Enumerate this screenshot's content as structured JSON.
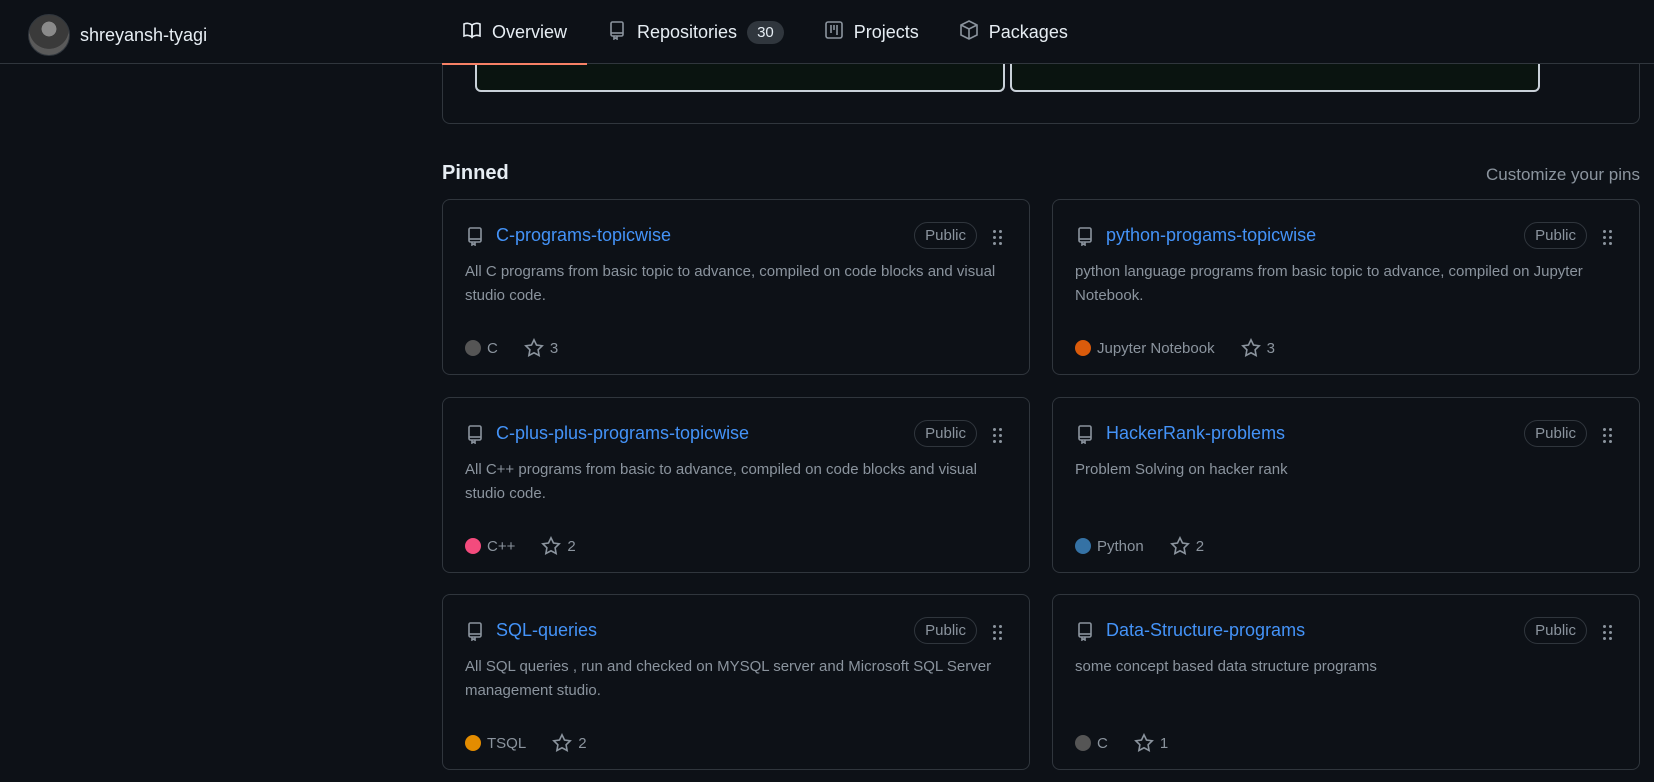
{
  "profile": {
    "username": "shreyansh-tyagi"
  },
  "tabs": [
    {
      "label": "Overview",
      "icon": "book-icon",
      "active": true
    },
    {
      "label": "Repositories",
      "icon": "repo-icon",
      "count": "30"
    },
    {
      "label": "Projects",
      "icon": "project-icon"
    },
    {
      "label": "Packages",
      "icon": "package-icon"
    }
  ],
  "pinned": {
    "title": "Pinned",
    "customize_label": "Customize your pins",
    "repos": [
      {
        "name": "C-programs-topicwise",
        "visibility": "Public",
        "description": "All C programs from basic topic to advance, compiled on code blocks and visual studio code.",
        "language": "C",
        "language_color": "#555555",
        "stars": "3"
      },
      {
        "name": "python-progams-topicwise",
        "visibility": "Public",
        "description": "python language programs from basic topic to advance, compiled on Jupyter Notebook.",
        "language": "Jupyter Notebook",
        "language_color": "#DA5B0B",
        "stars": "3"
      },
      {
        "name": "C-plus-plus-programs-topicwise",
        "visibility": "Public",
        "description": "All C++ programs from basic to advance, compiled on code blocks and visual studio code.",
        "language": "C++",
        "language_color": "#f34b7d",
        "stars": "2"
      },
      {
        "name": "HackerRank-problems",
        "visibility": "Public",
        "description": "Problem Solving on hacker rank",
        "language": "Python",
        "language_color": "#3572A5",
        "stars": "2"
      },
      {
        "name": "SQL-queries",
        "visibility": "Public",
        "description": "All SQL queries , run and checked on MYSQL server and Microsoft SQL Server management studio.",
        "language": "TSQL",
        "language_color": "#e38c00",
        "stars": "2"
      },
      {
        "name": "Data-Structure-programs",
        "visibility": "Public",
        "description": "some concept based data structure programs",
        "language": "C",
        "language_color": "#555555",
        "stars": "1"
      }
    ]
  },
  "colors": {
    "background": "#0d1117",
    "border": "#30363d",
    "link": "#4493f8",
    "muted": "#8b949e",
    "tab_underline": "#f78166"
  }
}
